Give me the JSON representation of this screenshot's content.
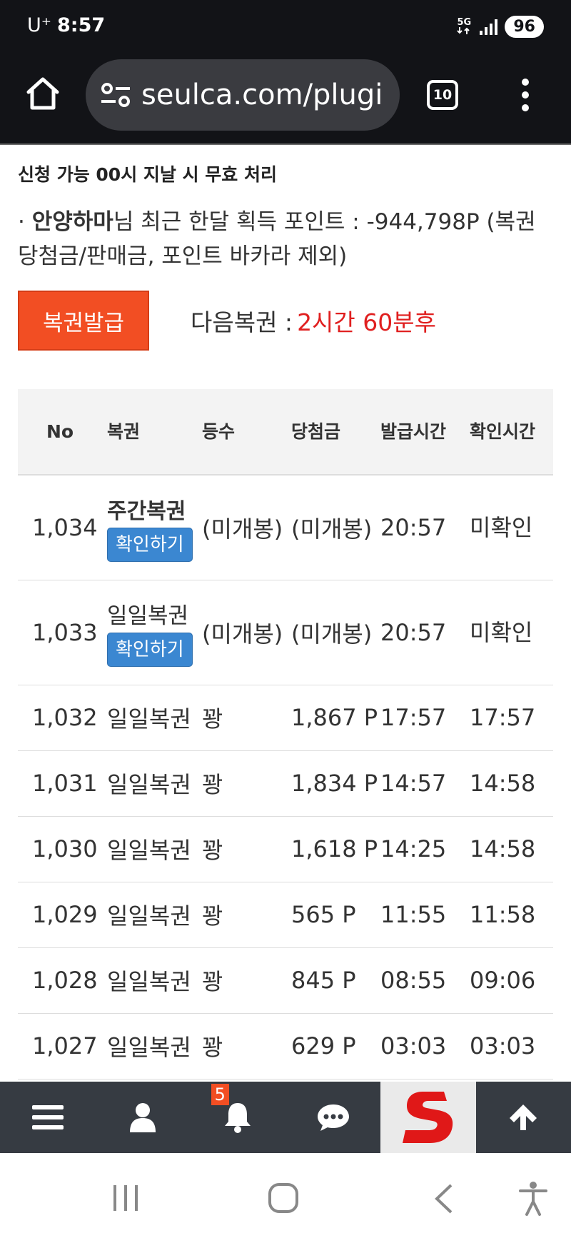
{
  "status_bar": {
    "carrier": "U⁺",
    "time": "8:57",
    "network": "5G",
    "battery": "96"
  },
  "browser": {
    "url": "seulca.com/plugi",
    "tab_count": "10"
  },
  "notice": "신청 가능 00시 지날 시 무효 처리",
  "points": {
    "bullet": "·",
    "username": "안양하마",
    "text": "님 최근 한달 획득 포인트 : -944,798P (복권 당첨금/판매금, 포인트 바카라 제외)"
  },
  "issue_button": "복권발급",
  "next_lottery": {
    "label": "다음복권 : ",
    "value": "2시간 60분후"
  },
  "table": {
    "headers": [
      "No",
      "복권",
      "등수",
      "당첨금",
      "발급시간",
      "확인시간"
    ],
    "rows": [
      {
        "no": "1,034",
        "type": "주간복권",
        "confirm": "확인하기",
        "grade": "(미개봉)",
        "prize": "(미개봉)",
        "issued": "20:57",
        "checked": "미확인"
      },
      {
        "no": "1,033",
        "type": "일일복권",
        "confirm": "확인하기",
        "grade": "(미개봉)",
        "prize": "(미개봉)",
        "issued": "20:57",
        "checked": "미확인"
      },
      {
        "no": "1,032",
        "type": "일일복권",
        "grade": "꽝",
        "prize": "1,867 P",
        "issued": "17:57",
        "checked": "17:57"
      },
      {
        "no": "1,031",
        "type": "일일복권",
        "grade": "꽝",
        "prize": "1,834 P",
        "issued": "14:57",
        "checked": "14:58"
      },
      {
        "no": "1,030",
        "type": "일일복권",
        "grade": "꽝",
        "prize": "1,618 P",
        "issued": "14:25",
        "checked": "14:58"
      },
      {
        "no": "1,029",
        "type": "일일복권",
        "grade": "꽝",
        "prize": "565 P",
        "issued": "11:55",
        "checked": "11:58"
      },
      {
        "no": "1,028",
        "type": "일일복권",
        "grade": "꽝",
        "prize": "845 P",
        "issued": "08:55",
        "checked": "09:06"
      },
      {
        "no": "1,027",
        "type": "일일복권",
        "grade": "꽝",
        "prize": "629 P",
        "issued": "03:03",
        "checked": "03:03"
      }
    ]
  },
  "site_nav": {
    "notification_count": "5",
    "items": [
      "menu-icon",
      "user-icon",
      "bell-icon",
      "chat-icon",
      "site-logo",
      "arrow-up-icon"
    ]
  },
  "colors": {
    "issue_button": "#f24e23",
    "countdown": "#e01f1f",
    "unconfirmed": "#f0a11a",
    "confirm_button": "#3b87d1",
    "site_nav_bg": "#363b42"
  }
}
